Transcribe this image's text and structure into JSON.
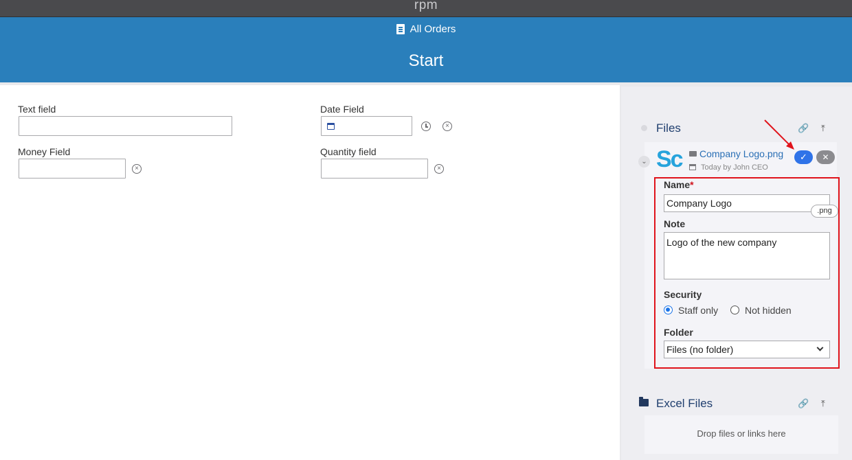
{
  "topbar": {
    "logo": "rpm"
  },
  "header": {
    "breadcrumb": "All Orders",
    "title": "Start"
  },
  "form": {
    "text_field": {
      "label": "Text field",
      "value": ""
    },
    "date_field": {
      "label": "Date Field",
      "value": ""
    },
    "money_field": {
      "label": "Money Field",
      "value": ""
    },
    "quantity_field": {
      "label": "Quantity field",
      "value": ""
    }
  },
  "files_panel": {
    "title": "Files",
    "file": {
      "logo": "Sc",
      "name": "Company Logo.png",
      "meta": "Today  by John CEO",
      "edit": {
        "name_label": "Name",
        "required_mark": "*",
        "name_value": "Company Logo",
        "extension": ".png",
        "note_label": "Note",
        "note_value": "Logo of the new company",
        "security_label": "Security",
        "security_options": [
          "Staff only",
          "Not hidden"
        ],
        "security_selected": "Staff only",
        "folder_label": "Folder",
        "folder_value": "Files (no folder)"
      }
    }
  },
  "excel_panel": {
    "title": "Excel Files",
    "drop_text": "Drop files or links here"
  },
  "colors": {
    "header": "#2a7fbb",
    "accent": "#2f73e8",
    "highlight": "#e0131b"
  }
}
